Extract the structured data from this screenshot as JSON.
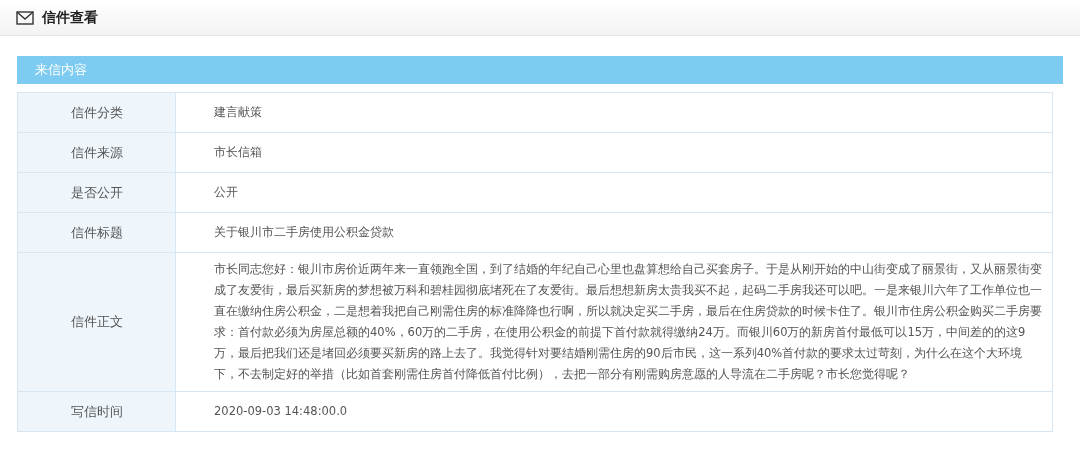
{
  "page": {
    "title": "信件查看"
  },
  "section": {
    "title": "来信内容"
  },
  "rows": [
    {
      "label": "信件分类",
      "value": "建言献策"
    },
    {
      "label": "信件来源",
      "value": "市长信箱"
    },
    {
      "label": "是否公开",
      "value": "公开"
    },
    {
      "label": "信件标题",
      "value": "关于银川市二手房使用公积金贷款"
    },
    {
      "label": "信件正文",
      "value": "市长同志您好：银川市房价近两年来一直领跑全国，到了结婚的年纪自己心里也盘算想给自己买套房子。于是从刚开始的中山街变成了丽景街，又从丽景街变成了友爱街，最后买新房的梦想被万科和碧桂园彻底堵死在了友爱街。最后想想新房太贵我买不起，起码二手房我还可以吧。一是来银川六年了工作单位也一直在缴纳住房公积金，二是想着我把自己刚需住房的标准降降也行啊，所以就决定买二手房，最后在住房贷款的时候卡住了。银川市住房公积金购买二手房要求：首付款必须为房屋总额的40%，60万的二手房，在使用公积金的前提下首付款就得缴纳24万。而银川60万的新房首付最低可以15万，中间差的的这9万，最后把我们还是堵回必须要买新房的路上去了。我觉得针对要结婚刚需住房的90后市民，这一系列40%首付款的要求太过苛刻，为什么在这个大环境下，不去制定好的举措（比如首套刚需住房首付降低首付比例），去把一部分有刚需购房意愿的人导流在二手房呢？市长您觉得呢？"
    },
    {
      "label": "写信时间",
      "value": "2020-09-03 14:48:00.0"
    }
  ]
}
